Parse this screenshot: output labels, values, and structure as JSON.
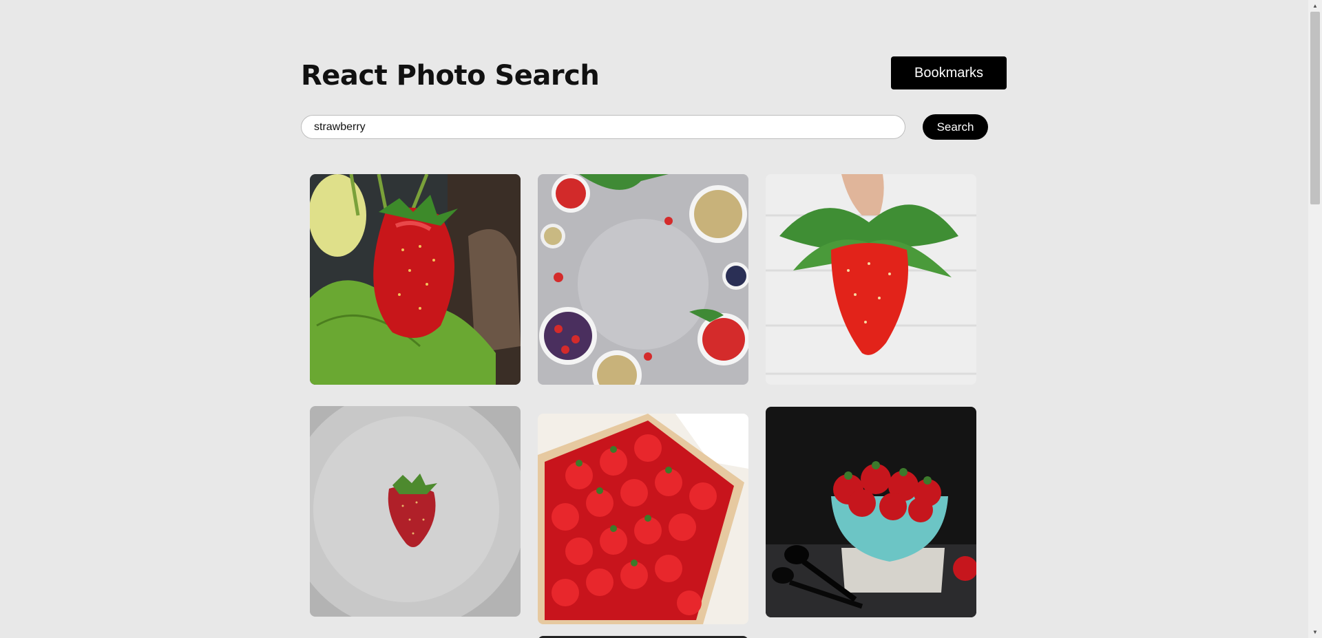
{
  "header": {
    "title": "React Photo Search",
    "bookmarks_label": "Bookmarks"
  },
  "search": {
    "value": "strawberry",
    "button_label": "Search"
  },
  "colors": {
    "background": "#e8e8e8",
    "button": "#000000",
    "button_text": "#ffffff"
  },
  "photos": [
    {
      "subject": "strawberry-on-plant"
    },
    {
      "subject": "strawberry-bowls-flatlay"
    },
    {
      "subject": "hand-holding-strawberry"
    },
    {
      "subject": "strawberry-on-plate"
    },
    {
      "subject": "strawberries-in-crate"
    },
    {
      "subject": "strawberries-in-teal-bowl"
    }
  ],
  "scrollbar": {
    "up_icon": "triangle-up-icon",
    "down_icon": "triangle-down-icon"
  }
}
